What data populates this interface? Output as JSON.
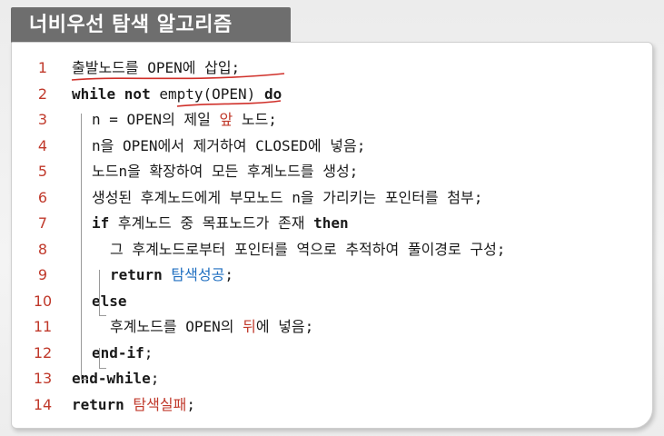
{
  "title": "너비우선 탐색 알고리즘",
  "lines": [
    {
      "num": "1",
      "t1": "출발노드를 OPEN에 삽입;"
    },
    {
      "num": "2",
      "kw1": "while not",
      "t1": " empty(OPEN) ",
      "kw2": "do"
    },
    {
      "num": "3",
      "t1": "n = OPEN의 제일 ",
      "r1": "앞",
      "t2": " 노드;"
    },
    {
      "num": "4",
      "t1": "n을 OPEN에서 제거하여 CLOSED에 넣음;"
    },
    {
      "num": "5",
      "t1": "노드n을 확장하여 모든 후계노드를 생성;"
    },
    {
      "num": "6",
      "t1": "생성된 후계노드에게 부모노드 n을 가리키는 포인터를 첨부;"
    },
    {
      "num": "7",
      "kw1": "if",
      "t1": " 후계노드 중 목표노드가 존재 ",
      "kw2": "then"
    },
    {
      "num": "8",
      "t1": "그 후계노드로부터 포인터를 역으로 추적하여 풀이경로 구성;"
    },
    {
      "num": "9",
      "kw1": "return",
      "b1": " 탐색성공",
      "t1": ";"
    },
    {
      "num": "10",
      "kw1": "else"
    },
    {
      "num": "11",
      "t1": "후계노드를 OPEN의 ",
      "r1": "뒤",
      "t2": "에 넣음;"
    },
    {
      "num": "12",
      "kw1": "end-if",
      "t1": ";"
    },
    {
      "num": "13",
      "kw1": "end-while",
      "t1": ";"
    },
    {
      "num": "14",
      "kw1": "return",
      "r1": " 탐색실패",
      "t1": ";"
    }
  ]
}
